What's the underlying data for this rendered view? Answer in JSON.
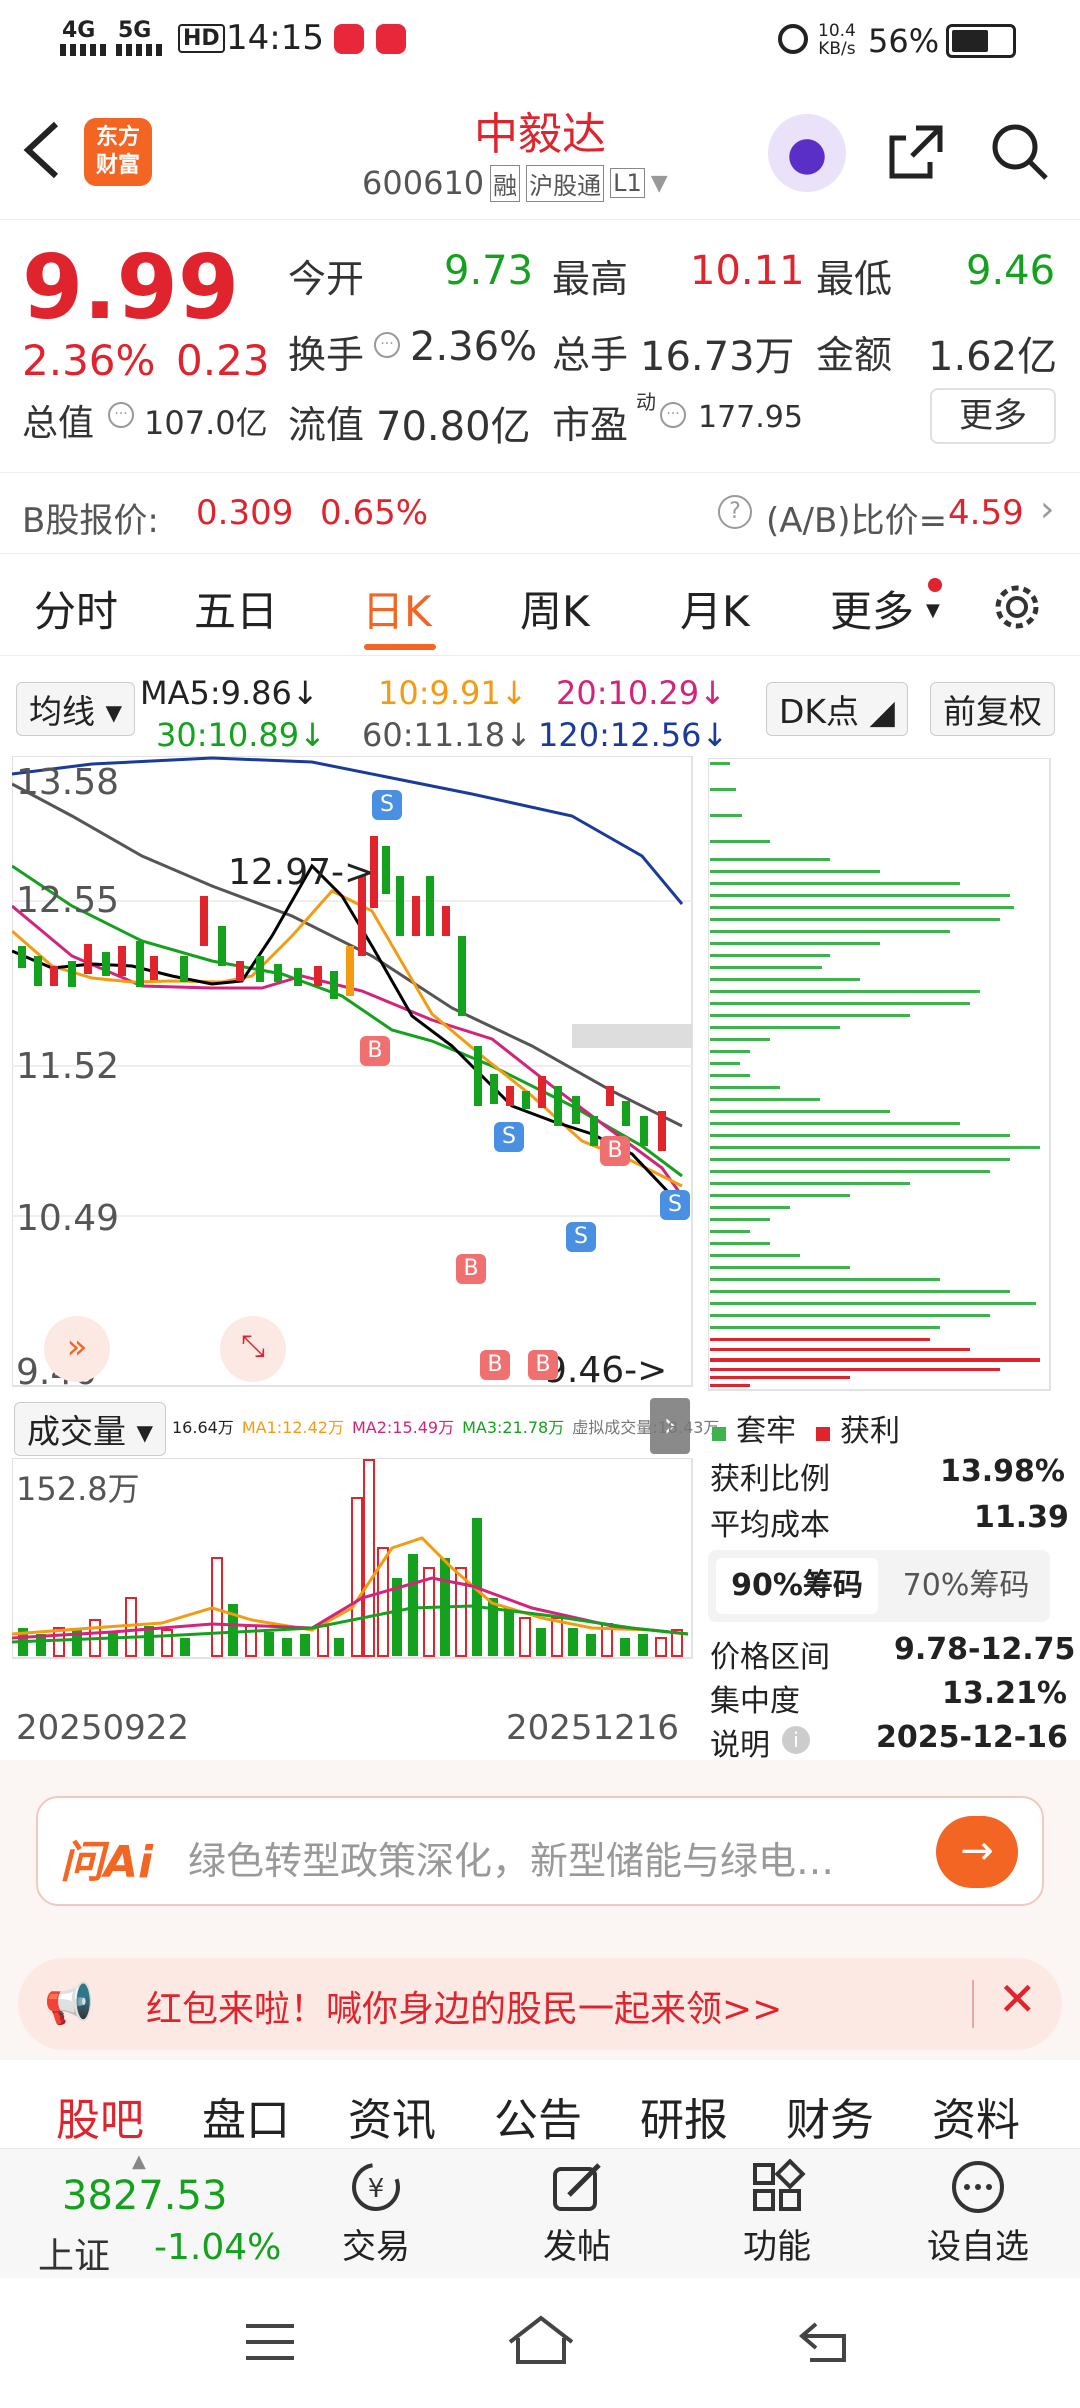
{
  "status": {
    "network1": "4G",
    "network2": "5G",
    "hd": "HD",
    "time": "14:15",
    "speed_top": "10.4",
    "speed_bottom": "KB/s",
    "battery": "56%"
  },
  "header": {
    "logo_line1": "东方",
    "logo_line2": "财富",
    "stock_name": "中毅达",
    "stock_code": "600610",
    "tag_margin": "融",
    "tag_connect": "沪股通",
    "tag_level": "L1"
  },
  "quote": {
    "price": "9.99",
    "change_pct": "2.36%",
    "change_amt": "0.23",
    "open_label": "今开",
    "open": "9.73",
    "high_label": "最高",
    "high": "10.11",
    "low_label": "最低",
    "low": "9.46",
    "turnover_label": "换手",
    "turnover": "2.36%",
    "volume_label": "总手",
    "volume": "16.73万",
    "amount_label": "金额",
    "amount": "1.62亿",
    "mktcap_label": "总值",
    "mktcap": "107.0亿",
    "float_label": "流值",
    "float_cap": "70.80亿",
    "pe_label": "市盈",
    "pe_sup": "动",
    "pe": "177.95",
    "more_label": "更多"
  },
  "bshare": {
    "label": "B股报价:",
    "price": "0.309",
    "pct": "0.65%",
    "ratio_label": "(A/B)比价=",
    "ratio": "4.59"
  },
  "tabs": [
    "分时",
    "五日",
    "日K",
    "周K",
    "月K",
    "更多"
  ],
  "ma": {
    "toggle": "均线",
    "ma5": "MA5:9.86",
    "ma10": "10:9.91",
    "ma20": "20:10.29",
    "ma30": "30:10.89",
    "ma60": "60:11.18",
    "ma120": "120:12.56",
    "dk": "DK点",
    "adjust": "前复权"
  },
  "price_axis": [
    "13.58",
    "12.55",
    "11.52",
    "10.49",
    "9.46"
  ],
  "annotations": {
    "high_mark": "12.97->",
    "low_mark": "9.46->"
  },
  "volume": {
    "toggle": "成交量",
    "v": "16.64万",
    "ma1": "MA1:12.42万",
    "ma2": "MA2:15.49万",
    "ma3": "MA3:21.78万",
    "sim": "虚拟成交量:18.43万",
    "max_label": "152.8万",
    "start_date": "20250922",
    "end_date": "20251216"
  },
  "chips": {
    "legend_locked": "套牢",
    "legend_profit": "获利",
    "profit_ratio_label": "获利比例",
    "profit_ratio": "13.98%",
    "avg_cost_label": "平均成本",
    "avg_cost": "11.39",
    "tab90": "90%筹码",
    "tab70": "70%筹码",
    "range_label": "价格区间",
    "range": "9.78-12.75",
    "conc_label": "集中度",
    "conc": "13.21%",
    "note_label": "说明",
    "note_date": "2025-12-16"
  },
  "ai": {
    "logo": "问Ai",
    "placeholder": "绿色转型政策深化，新型储能与绿电…"
  },
  "promo": {
    "text": "红包来啦！喊你身边的股民一起来领>>"
  },
  "bottom_tabs": [
    "股吧",
    "盘口",
    "资讯",
    "公告",
    "研报",
    "财务",
    "资料"
  ],
  "dock": {
    "index_value": "3827.53",
    "index_name": "上证",
    "index_change": "-1.04%",
    "trade": "交易",
    "post": "发帖",
    "func": "功能",
    "watch": "设自选"
  },
  "colors": {
    "up": "#e0242e",
    "down": "#14a11e",
    "brand": "#f26522",
    "ma5": "#000000",
    "ma10": "#f39c12",
    "ma20": "#d4237a",
    "ma30": "#14a11e",
    "ma60": "#555555",
    "ma120": "#1a3a9c"
  }
}
